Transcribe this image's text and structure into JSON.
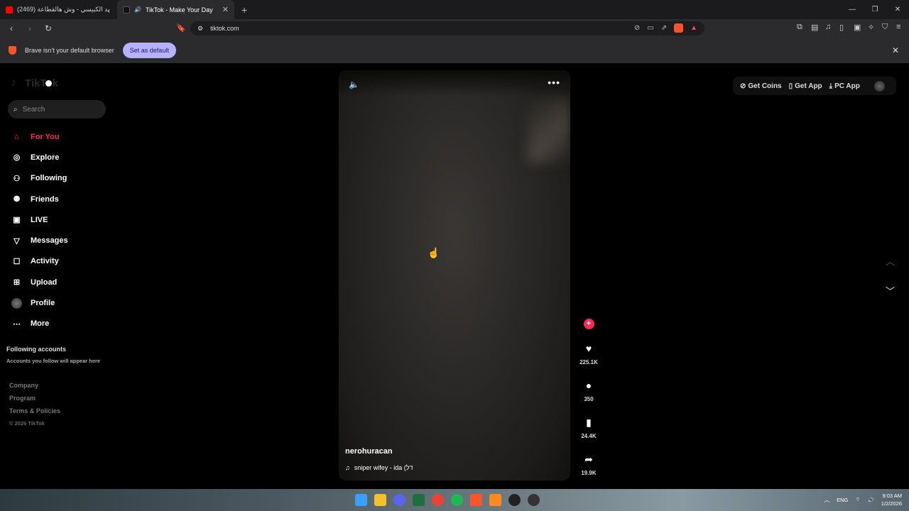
{
  "browser": {
    "tabs": [
      {
        "label": "(2469) فهد الكبيسي - وش هالقطاعة (...",
        "active": false
      },
      {
        "label": "TikTok - Make Your Day",
        "active": true
      }
    ],
    "url": "tiktok.com",
    "infobar_text": "Brave isn't your default browser",
    "set_default_label": "Set as default"
  },
  "sidebar": {
    "search_placeholder": "Search",
    "nav": [
      {
        "label": "For You",
        "icon": "home-icon",
        "active": true
      },
      {
        "label": "Explore",
        "icon": "compass-icon"
      },
      {
        "label": "Following",
        "icon": "following-icon"
      },
      {
        "label": "Friends",
        "icon": "friends-icon"
      },
      {
        "label": "LIVE",
        "icon": "live-icon"
      },
      {
        "label": "Messages",
        "icon": "messages-icon"
      },
      {
        "label": "Activity",
        "icon": "activity-icon"
      },
      {
        "label": "Upload",
        "icon": "upload-icon"
      },
      {
        "label": "Profile",
        "icon": "avatar"
      },
      {
        "label": "More",
        "icon": "more-icon"
      }
    ],
    "following_accounts_title": "Following accounts",
    "following_accounts_sub": "Accounts you follow will appear here",
    "footer": [
      "Company",
      "Program",
      "Terms & Policies"
    ],
    "copyright": "© 2026 TikTok"
  },
  "video": {
    "author": "nerohuracan",
    "music": "sniper wifey - ida (דל"
  },
  "actions": {
    "likes": "225.1K",
    "comments": "350",
    "saves": "24.4K",
    "shares": "19.9K"
  },
  "topright": {
    "coins": "Get Coins",
    "app": "Get App",
    "pc_app": "PC App"
  },
  "system": {
    "lang": "ENG",
    "time": "9:03 AM",
    "date": "1/2/2026"
  }
}
